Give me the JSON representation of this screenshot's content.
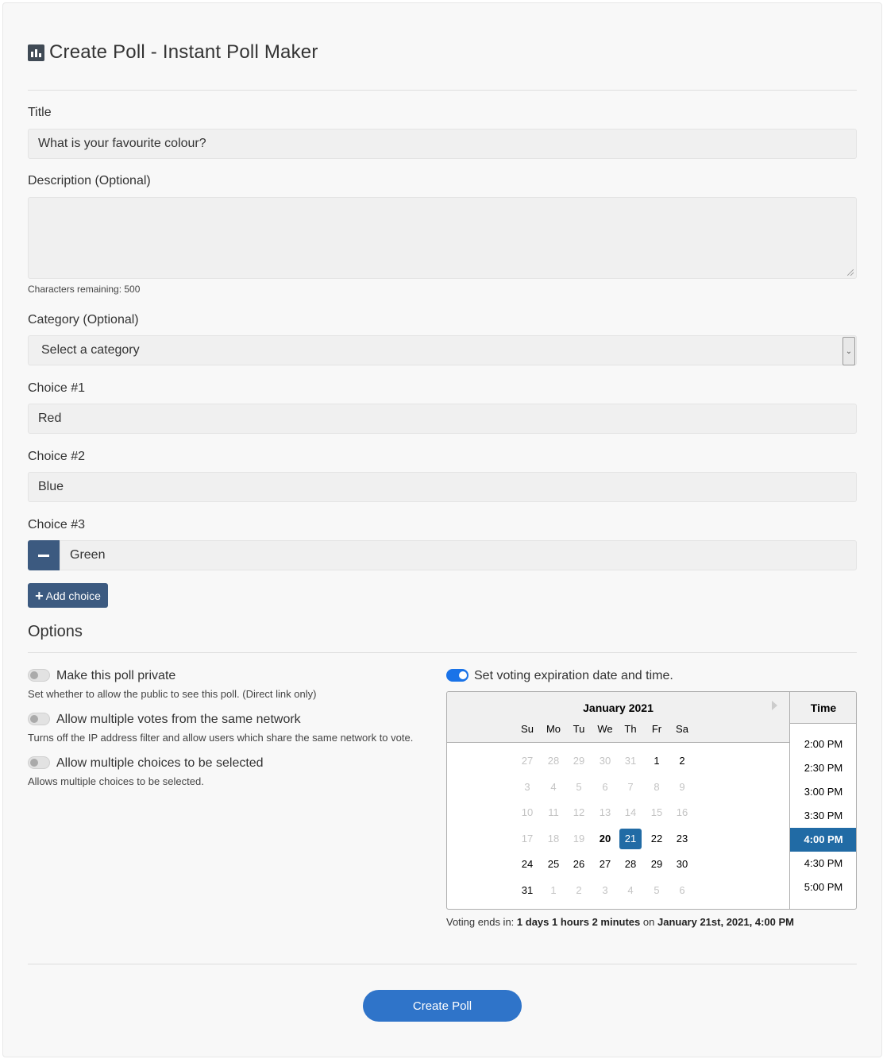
{
  "page": {
    "title": "Create Poll - Instant Poll Maker"
  },
  "form": {
    "title_label": "Title",
    "title_value": "What is your favourite colour?",
    "description_label": "Description (Optional)",
    "description_value": "",
    "characters_remaining": "Characters remaining: 500",
    "category_label": "Category (Optional)",
    "category_selected": "Select a category",
    "choices": [
      {
        "label": "Choice #1",
        "value": "Red"
      },
      {
        "label": "Choice #2",
        "value": "Blue"
      },
      {
        "label": "Choice #3",
        "value": "Green"
      }
    ],
    "add_choice_label": "Add choice"
  },
  "options": {
    "heading": "Options",
    "private": {
      "label": "Make this poll private",
      "desc": "Set whether to allow the public to see this poll. (Direct link only)",
      "enabled": false
    },
    "multi_votes": {
      "label": "Allow multiple votes from the same network",
      "desc": "Turns off the IP address filter and allow users which share the same network to vote.",
      "enabled": false
    },
    "multi_choices": {
      "label": "Allow multiple choices to be selected",
      "desc": "Allows multiple choices to be selected.",
      "enabled": false
    },
    "expiration": {
      "label": "Set voting expiration date and time.",
      "enabled": true
    }
  },
  "calendar": {
    "month": "January 2021",
    "weekdays": [
      "Su",
      "Mo",
      "Tu",
      "We",
      "Th",
      "Fr",
      "Sa"
    ],
    "weeks": [
      [
        "27",
        "28",
        "29",
        "30",
        "31",
        "1",
        "2"
      ],
      [
        "3",
        "4",
        "5",
        "6",
        "7",
        "8",
        "9"
      ],
      [
        "10",
        "11",
        "12",
        "13",
        "14",
        "15",
        "16"
      ],
      [
        "17",
        "18",
        "19",
        "20",
        "21",
        "22",
        "23"
      ],
      [
        "24",
        "25",
        "26",
        "27",
        "28",
        "29",
        "30"
      ],
      [
        "31",
        "1",
        "2",
        "3",
        "4",
        "5",
        "6"
      ]
    ],
    "selected_day": "21",
    "today_day": "20",
    "time_header": "Time",
    "times": [
      "2:00 PM",
      "2:30 PM",
      "3:00 PM",
      "3:30 PM",
      "4:00 PM",
      "4:30 PM",
      "5:00 PM"
    ],
    "selected_time": "4:00 PM"
  },
  "voting_ends": {
    "prefix": "Voting ends in:",
    "duration": "1 days 1 hours 2 minutes",
    "on": "on",
    "date": "January 21st, 2021, 4:00 PM"
  },
  "submit_label": "Create Poll",
  "colors": {
    "accent": "#2f74c9",
    "button_dark": "#3c5a80",
    "calendar_selected": "#216ba5",
    "toggle_on": "#1a73e8"
  }
}
